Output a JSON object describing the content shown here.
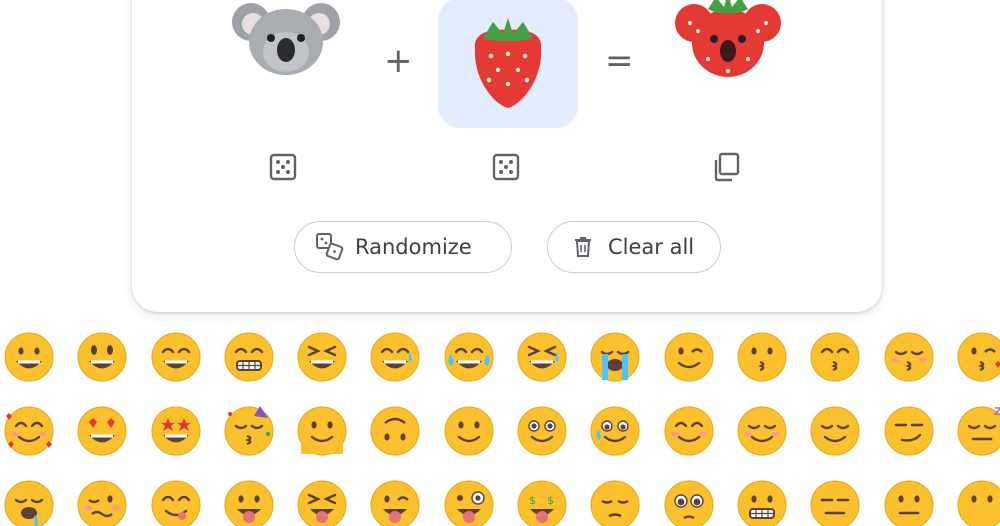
{
  "mixer": {
    "left_emoji": {
      "name": "koala",
      "selected": false
    },
    "operator_plus": "+",
    "right_emoji": {
      "name": "strawberry",
      "selected": true
    },
    "operator_equals": "=",
    "result_emoji": {
      "name": "koala-strawberry-mix"
    },
    "left_random_icon": "dice-icon",
    "right_random_icon": "dice-icon",
    "copy_icon": "copy-icon"
  },
  "actions": {
    "randomize_label": "Randomize",
    "randomize_icon": "shuffle-dice-icon",
    "clear_label": "Clear all",
    "clear_icon": "trash-icon"
  },
  "emoji_grid": {
    "rows": [
      [
        "grinning-face",
        "grinning-face-big-eyes",
        "grinning-smiling-eyes",
        "beaming-face",
        "grinning-squinting",
        "grinning-sweat",
        "face-tears-of-joy",
        "rolling-laughing",
        "loudly-crying",
        "winking-face",
        "kissing-face",
        "kissing-smiling-eyes",
        "kissing-closed-eyes",
        "face-blowing-kiss"
      ],
      [
        "smiling-hearts",
        "heart-eyes",
        "star-struck",
        "partying-face",
        "melting-face",
        "upside-down-face",
        "slightly-smiling",
        "holding-back-tears",
        "face-holding-tears",
        "smiling-face",
        "relaxed-face",
        "relieved-face",
        "smirking-face",
        "sleepy-face"
      ],
      [
        "drooling-face",
        "woozy-face",
        "face-savoring-food",
        "face-with-tongue",
        "squinting-tongue",
        "winking-tongue",
        "zany-face",
        "money-face",
        "pensive-face",
        "pleading-face",
        "grimacing-face",
        "expressionless-face",
        "neutral-face",
        "face-no-mouth"
      ]
    ]
  },
  "colors": {
    "emoji_yellow": "#fbc02d",
    "selected_bg": "#e3ecfb",
    "outline": "#c9cdd2",
    "text": "#3c4043"
  }
}
